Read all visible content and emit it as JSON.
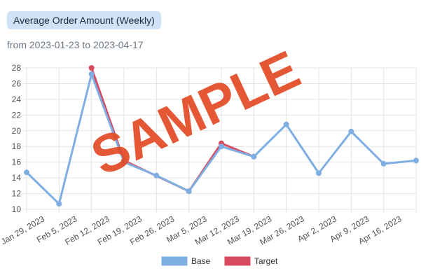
{
  "header": {
    "title": "Average Order Amount (Weekly)",
    "subtitle": "from 2023-01-23 to 2023-04-17"
  },
  "watermark": "SAMPLE",
  "colors": {
    "base": "#7eaee2",
    "target": "#d84a5f",
    "watermark": "#e24a26",
    "grid": "#e4e4e4",
    "badge_bg": "#cfe2f6"
  },
  "chart_data": {
    "type": "line",
    "categories": [
      "Jan 29, 2023",
      "Feb 5, 2023",
      "Feb 12, 2023",
      "Feb 19, 2023",
      "Feb 26, 2023",
      "Mar 5, 2023",
      "Mar 12, 2023",
      "Mar 19, 2023",
      "Mar 26, 2023",
      "Apr 2, 2023",
      "Apr 9, 2023",
      "Apr 16, 2023"
    ],
    "x_index": [
      0,
      1,
      2,
      3,
      4,
      5,
      6,
      7,
      8,
      9,
      10,
      11,
      12,
      13,
      14,
      15,
      16,
      17,
      18,
      19,
      20,
      21,
      22,
      23,
      24,
      25,
      26,
      27,
      28,
      29,
      30,
      31,
      32,
      33,
      34,
      35,
      36,
      37,
      38,
      39,
      40,
      41,
      42,
      43,
      44,
      45,
      46,
      47,
      48,
      49,
      50,
      51,
      52,
      53,
      54,
      55,
      56,
      57,
      58,
      59,
      60,
      61,
      62,
      63,
      64,
      65,
      66,
      67,
      68,
      69,
      70,
      71,
      72,
      73,
      74,
      75,
      76,
      77,
      78,
      79,
      80,
      81,
      82,
      83,
      84
    ],
    "series": [
      {
        "name": "Base",
        "points": [
          [
            0,
            14.7
          ],
          [
            7,
            10.7
          ],
          [
            14,
            27.2
          ],
          [
            21,
            16.0
          ],
          [
            28,
            14.3
          ],
          [
            35,
            12.3
          ],
          [
            42,
            18.0
          ],
          [
            49,
            16.7
          ],
          [
            56,
            20.8
          ],
          [
            63,
            14.6
          ],
          [
            70,
            19.9
          ],
          [
            77,
            15.8
          ],
          [
            84,
            16.2
          ]
        ]
      },
      {
        "name": "Target",
        "points": [
          [
            14,
            28.0
          ],
          [
            21,
            16.2
          ],
          [
            35,
            12.3
          ],
          [
            42,
            18.4
          ],
          [
            49,
            16.7
          ]
        ]
      }
    ],
    "ylim": [
      10,
      28
    ],
    "yticks": [
      10,
      12,
      14,
      16,
      18,
      20,
      22,
      24,
      26,
      28
    ],
    "grid": true,
    "legend": "bottom"
  },
  "legend": {
    "items": [
      {
        "label": "Base"
      },
      {
        "label": "Target"
      }
    ]
  }
}
